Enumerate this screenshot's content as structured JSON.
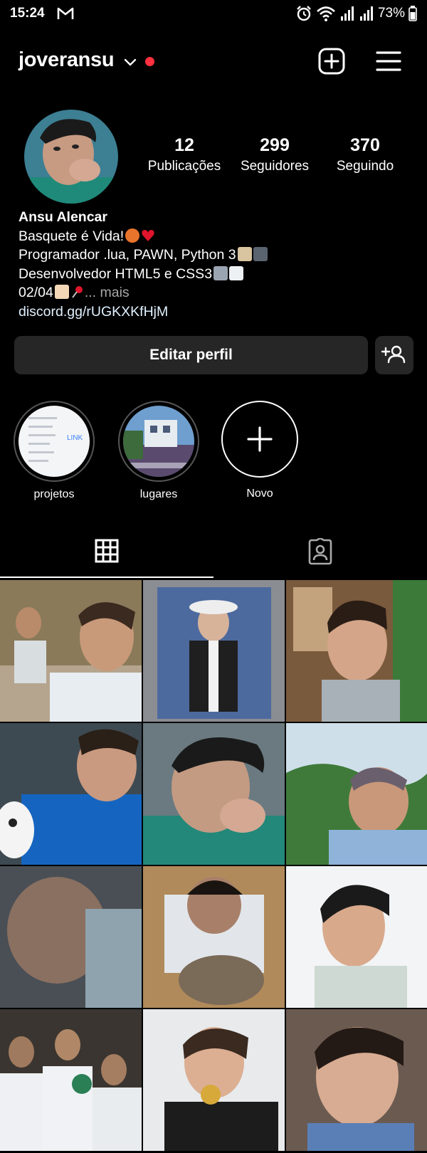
{
  "status_bar": {
    "time": "15:24",
    "battery": "73%",
    "icons": [
      "gmail-icon",
      "alarm-icon",
      "wifi-icon",
      "signal-icon",
      "signal-icon",
      "battery-icon"
    ]
  },
  "header": {
    "username": "joveransu",
    "has_notification_dot": true,
    "accent_color": "#ff3040"
  },
  "profile": {
    "stats": [
      {
        "value": "12",
        "label": "Publicações"
      },
      {
        "value": "299",
        "label": "Seguidores"
      },
      {
        "value": "370",
        "label": "Seguindo"
      }
    ],
    "name": "Ansu Alencar",
    "bio_lines": [
      "Basquete é Vida!",
      "Programador .lua, PAWN, Python 3",
      "Desenvolvedor HTML5 e CSS3",
      "02/04"
    ],
    "bio_more": "... mais",
    "link": "discord.gg/rUGKXKfHjM"
  },
  "actions": {
    "edit_profile": "Editar perfil"
  },
  "highlights": [
    {
      "label": "projetos"
    },
    {
      "label": "lugares"
    },
    {
      "label": "Novo"
    }
  ],
  "highlight_thumb_text": "LINK",
  "tabs": [
    {
      "name": "posts-grid",
      "icon": "grid-icon",
      "active": true
    },
    {
      "name": "tagged",
      "icon": "tagged-person-icon",
      "active": false
    }
  ],
  "posts_count": 12,
  "colors": {
    "background": "#000000",
    "button_bg": "#262626",
    "link": "#e0f1ff",
    "muted": "#a8a8a8"
  }
}
